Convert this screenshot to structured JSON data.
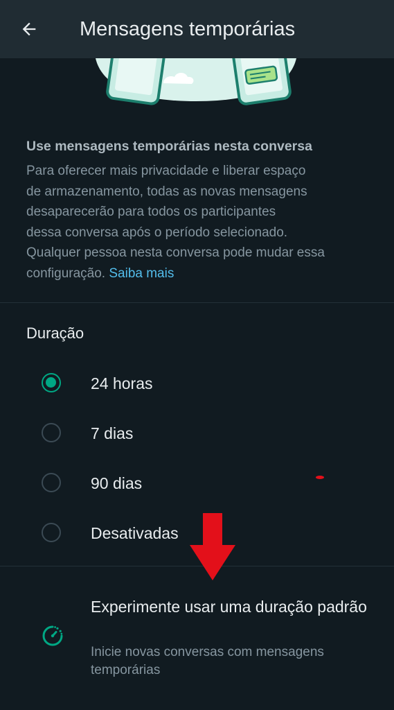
{
  "header": {
    "title": "Mensagens temporárias"
  },
  "description": {
    "title": "Use mensagens temporárias nesta conversa",
    "lines": [
      "Para oferecer mais privacidade e liberar espaço",
      "de armazenamento, todas as novas mensagens",
      "desaparecerão para todos os participantes",
      "dessa conversa após o período selecionado.",
      "Qualquer pessoa nesta conversa pode mudar essa"
    ],
    "last_line_prefix": "configuração.",
    "learn_more": "Saiba mais"
  },
  "duration": {
    "label": "Duração",
    "options": [
      {
        "label": "24 horas",
        "selected": true
      },
      {
        "label": "7 dias",
        "selected": false
      },
      {
        "label": "90 dias",
        "selected": false
      },
      {
        "label": "Desativadas",
        "selected": false
      }
    ]
  },
  "suggestion": {
    "title": "Experimente usar uma duração padrão",
    "subtitle": "Inicie novas conversas com mensagens temporárias"
  },
  "colors": {
    "background": "#111b21",
    "header": "#202c33",
    "accent": "#00a884",
    "link": "#53bdeb",
    "annotation": "#e3101a"
  },
  "icons": {
    "back": "arrow-left-icon",
    "suggestion": "timer-icon"
  }
}
